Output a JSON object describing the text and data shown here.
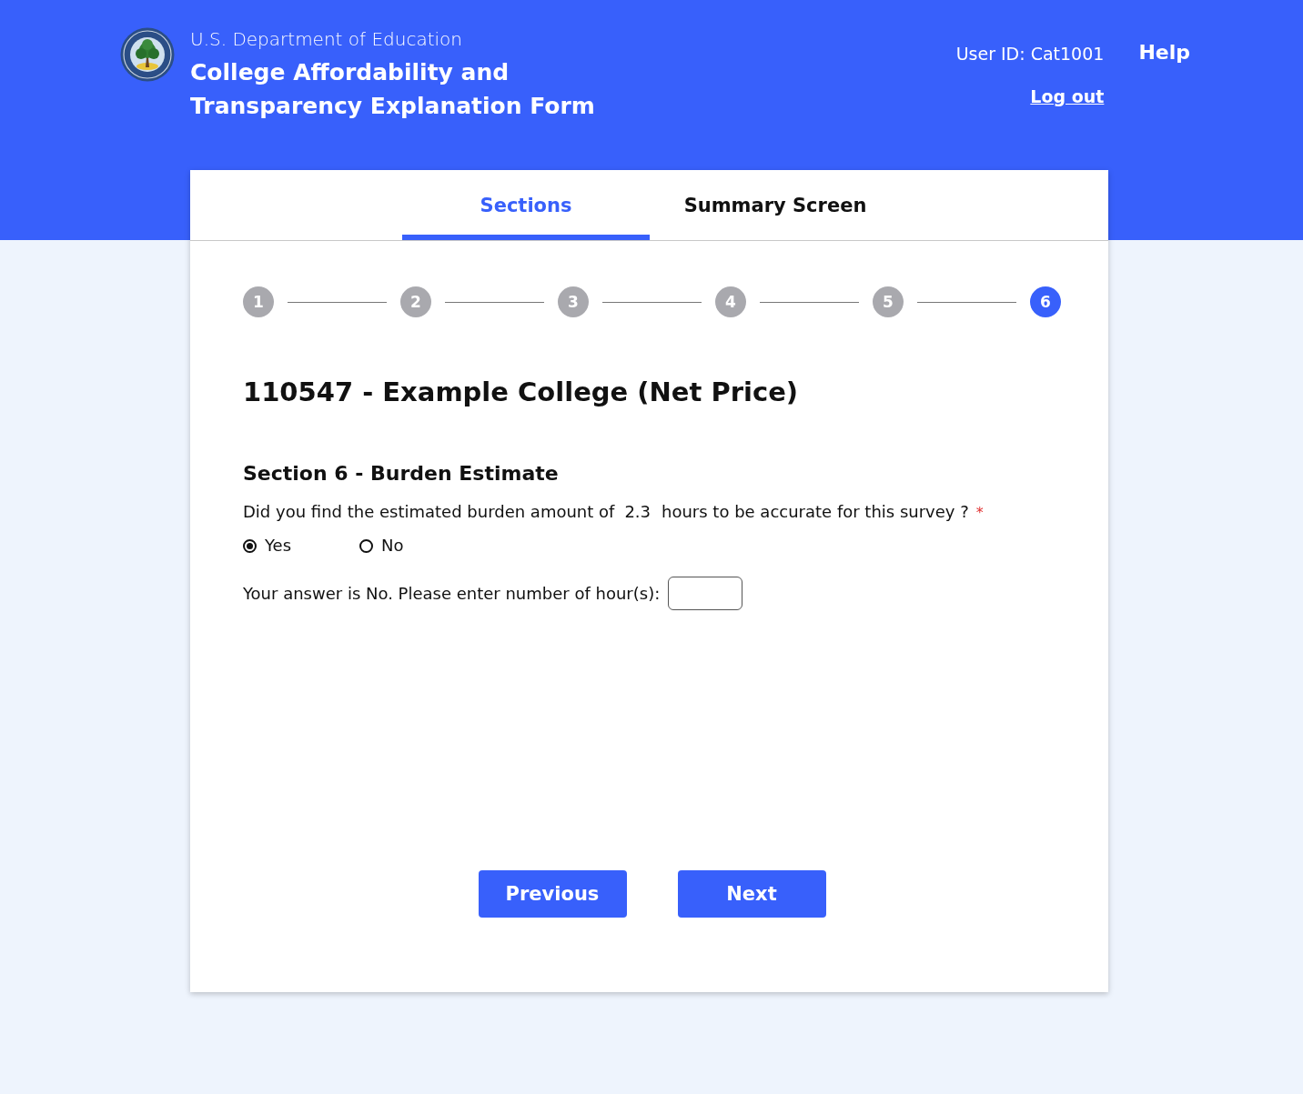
{
  "header": {
    "agency": "U.S. Department of Education",
    "title": "College Affordability and Transparency Explanation Form",
    "user_id": "User ID: Cat1001",
    "logout": "Log out",
    "help": "Help"
  },
  "tabs": [
    {
      "label": "Sections",
      "selected": true
    },
    {
      "label": "Summary Screen",
      "selected": false
    }
  ],
  "steps": [
    {
      "label": "1",
      "selected": false
    },
    {
      "label": "2",
      "selected": false
    },
    {
      "label": "3",
      "selected": false
    },
    {
      "label": "4",
      "selected": false
    },
    {
      "label": "5",
      "selected": false
    },
    {
      "label": "6",
      "selected": true
    }
  ],
  "form": {
    "title": "110547 - Example College (Net Price)",
    "section_heading": "Section 6 - Burden Estimate",
    "question": {
      "prefix": "Did you find the estimated burden amount of",
      "value": "2.3",
      "suffix": "hours to be accurate for this survey ?",
      "required_mark": "*"
    },
    "options": [
      {
        "label": "Yes",
        "selected": true
      },
      {
        "label": "No",
        "selected": false
      }
    ],
    "hours_field": {
      "label": "Your answer is No. Please enter number of hour(s):"
    }
  },
  "buttons": [
    "Previous",
    "Next"
  ]
}
